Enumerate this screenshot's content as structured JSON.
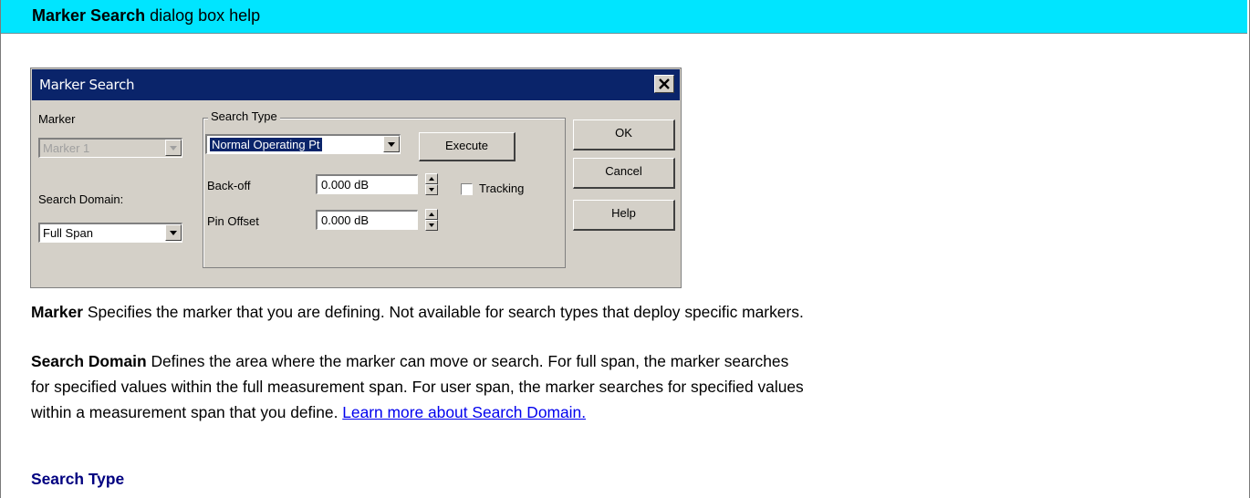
{
  "header": {
    "title_bold": "Marker Search",
    "title_rest": " dialog box help"
  },
  "dialog": {
    "title": "Marker Search",
    "marker_label": "Marker",
    "marker_value": "Marker 1",
    "search_domain_label": "Search Domain:",
    "search_domain_value": "Full Span",
    "search_type_label": "Search Type",
    "search_type_value": "Normal Operating Pt",
    "execute_label": "Execute",
    "backoff_label": "Back-off",
    "backoff_value": "0.000 dB",
    "tracking_label": "Tracking",
    "pin_offset_label": "Pin Offset",
    "pin_offset_value": "0.000 dB",
    "ok_label": "OK",
    "cancel_label": "Cancel",
    "help_label": "Help"
  },
  "content": {
    "marker_term": "Marker",
    "marker_desc": "  Specifies the marker that you are defining. Not available for search types that deploy specific markers.",
    "domain_term": "Search Domain",
    "domain_desc_1": "  Defines the area where the marker can move or search. For full span, the marker searches",
    "domain_desc_2": "for specified values within the full measurement span. For user span, the marker searches for specified values",
    "domain_desc_3": "within a measurement span that you define. ",
    "domain_link": "Learn more about Search Domain.",
    "section_title": "Search Type"
  },
  "colors": {
    "header_bg": "#00e5ff",
    "titlebar": "#0a246a",
    "dialog_bg": "#d4d0c8",
    "link": "#0000ee",
    "section_title": "#000080"
  }
}
